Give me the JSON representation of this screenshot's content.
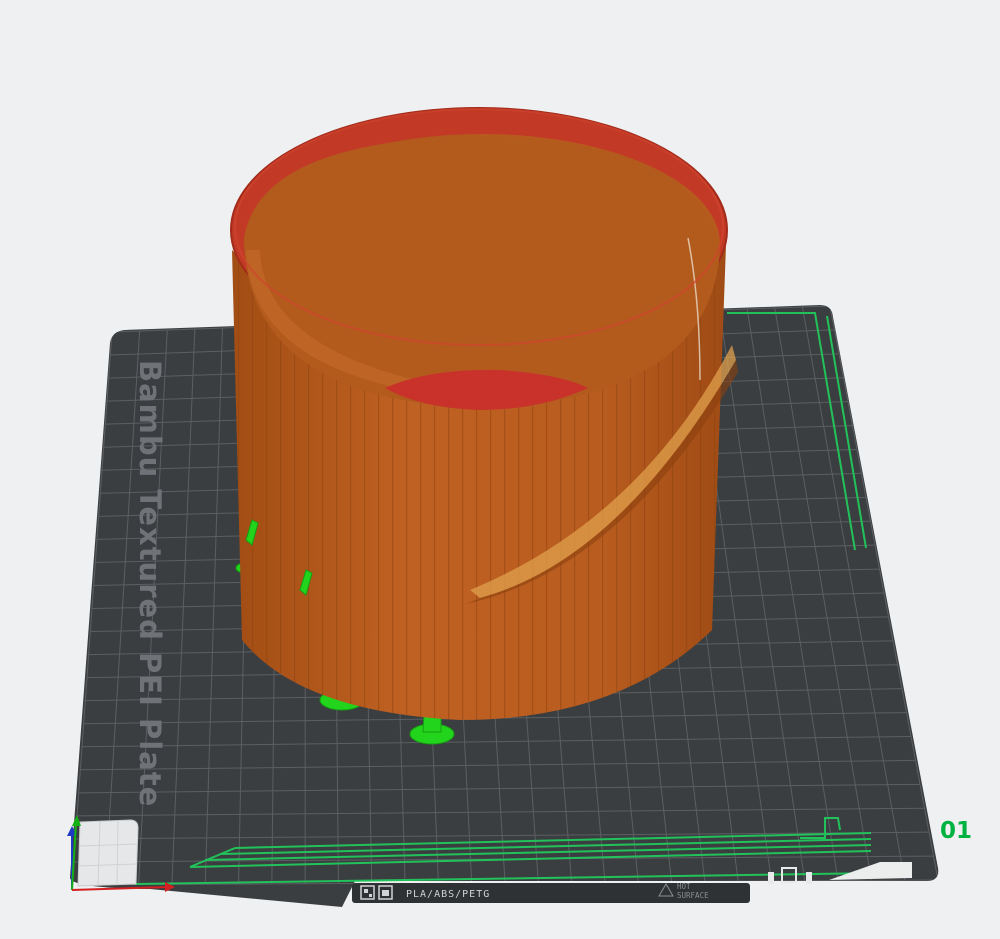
{
  "scene": {
    "background_color": "#eef0f1",
    "plate": {
      "label": "Bambu Textured PEI Plate",
      "number": "01",
      "footer_filament_text": "PLA/ABS/PETG",
      "footer_warning_line1": "HOT",
      "footer_warning_line2": "SURFACE",
      "colors": {
        "plate": "#3b3e40",
        "grid": "#5c6063",
        "label": "#6f7378",
        "plate_number": "#00b341",
        "boundary": "#22c25a"
      }
    },
    "model": {
      "part": "cylindrical-cup",
      "colors": {
        "wall": "#b85c1f",
        "rim": "#c23a26",
        "support": "#1fd11f",
        "seam": "#e6a24a"
      }
    },
    "axis_gizmo": {
      "x_color": "#d42020",
      "y_color": "#14b014",
      "z_color": "#1f39c2"
    }
  }
}
